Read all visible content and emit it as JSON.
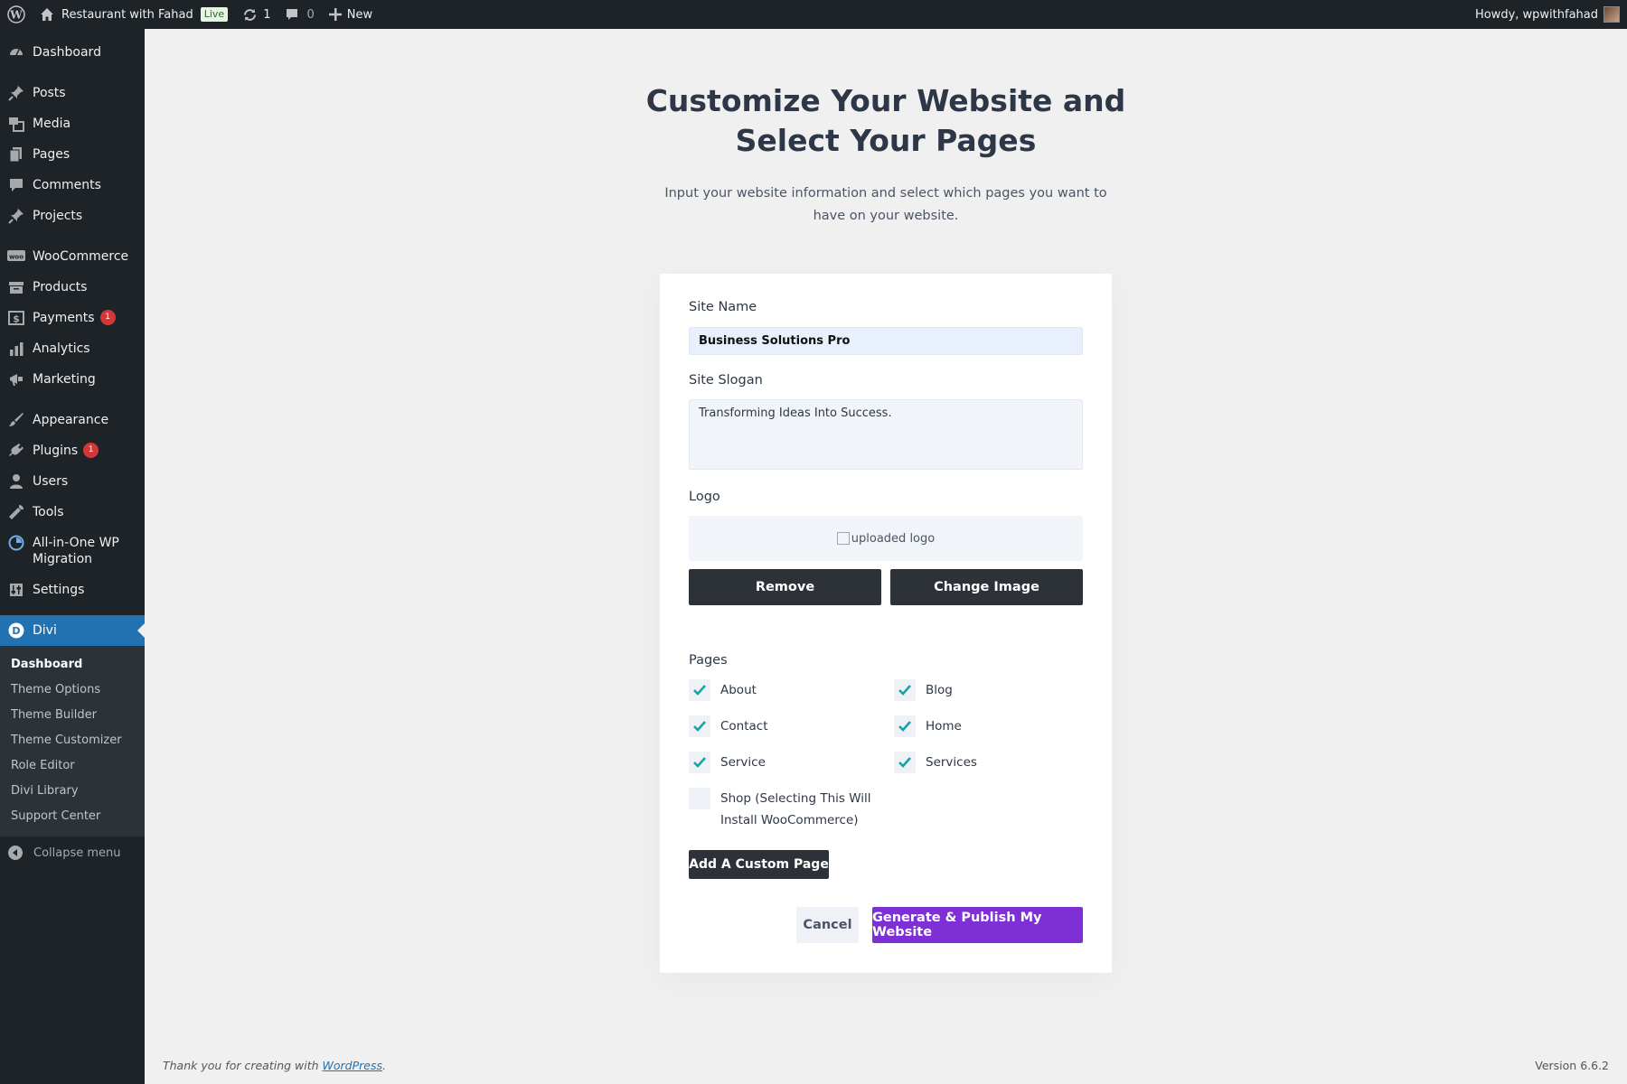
{
  "adminbar": {
    "site_name": "Restaurant with Fahad",
    "live_badge": "Live",
    "updates_count": "1",
    "comments_count": "0",
    "new_label": "New",
    "howdy": "Howdy, wpwithfahad"
  },
  "sidebar": {
    "items": [
      {
        "label": "Dashboard",
        "icon": "dashboard-icon"
      },
      {
        "label": "Posts",
        "icon": "pin-icon"
      },
      {
        "label": "Media",
        "icon": "media-icon"
      },
      {
        "label": "Pages",
        "icon": "pages-icon"
      },
      {
        "label": "Comments",
        "icon": "comment-icon"
      },
      {
        "label": "Projects",
        "icon": "pin-icon"
      },
      {
        "label": "WooCommerce",
        "icon": "woo-icon"
      },
      {
        "label": "Products",
        "icon": "archive-icon"
      },
      {
        "label": "Payments",
        "icon": "dollar-icon",
        "badge": "1"
      },
      {
        "label": "Analytics",
        "icon": "bar-chart-icon"
      },
      {
        "label": "Marketing",
        "icon": "megaphone-icon"
      },
      {
        "label": "Appearance",
        "icon": "brush-icon"
      },
      {
        "label": "Plugins",
        "icon": "plug-icon",
        "badge": "1"
      },
      {
        "label": "Users",
        "icon": "user-icon"
      },
      {
        "label": "Tools",
        "icon": "wrench-icon"
      },
      {
        "label": "All-in-One WP Migration",
        "icon": "migration-icon"
      },
      {
        "label": "Settings",
        "icon": "settings-icon"
      },
      {
        "label": "Divi",
        "icon": "divi-icon"
      }
    ],
    "submenu": [
      "Dashboard",
      "Theme Options",
      "Theme Builder",
      "Theme Customizer",
      "Role Editor",
      "Divi Library",
      "Support Center"
    ],
    "collapse_label": "Collapse menu",
    "current_color": "#2271b1"
  },
  "main": {
    "title_line1": "Customize Your Website and",
    "title_line2": "Select Your Pages",
    "subtitle": "Input your website information and select which pages you want to have on your website.",
    "site_name_label": "Site Name",
    "site_name_value": "Business Solutions Pro",
    "site_slogan_label": "Site Slogan",
    "site_slogan_value": "Transforming Ideas Into Success.",
    "logo_label": "Logo",
    "logo_alt": "uploaded logo",
    "remove_button": "Remove",
    "change_image_button": "Change Image",
    "pages_label": "Pages",
    "pages": [
      {
        "label": "About",
        "checked": true
      },
      {
        "label": "Blog",
        "checked": true
      },
      {
        "label": "Contact",
        "checked": true
      },
      {
        "label": "Home",
        "checked": true
      },
      {
        "label": "Service",
        "checked": true
      },
      {
        "label": "Services",
        "checked": true
      },
      {
        "label": "Shop (Selecting This Will Install WooCommerce)",
        "checked": false
      }
    ],
    "add_custom_page_button": "Add A Custom Page",
    "cancel_button": "Cancel",
    "publish_button": "Generate & Publish My Website",
    "accent_color": "#7e2fd6",
    "check_color": "#17a2a2"
  },
  "footer": {
    "thanks_prefix": "Thank you for creating with ",
    "wordpress_link": "WordPress",
    "thanks_suffix": ".",
    "version": "Version 6.6.2"
  }
}
